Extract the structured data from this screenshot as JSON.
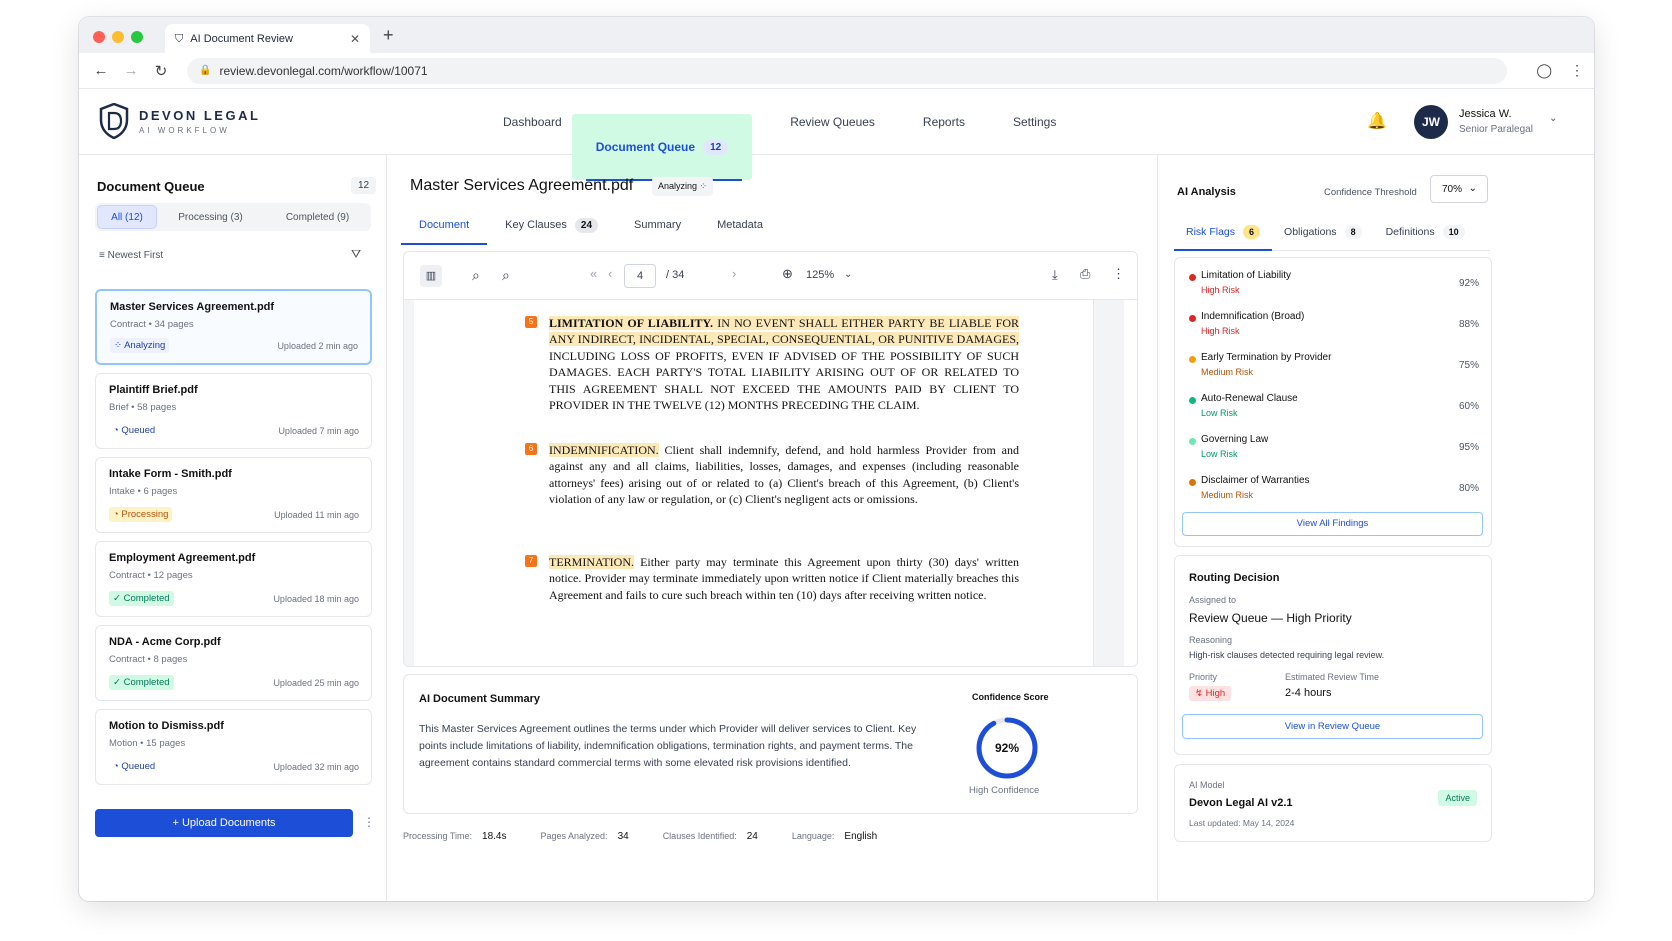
{
  "browser": {
    "tab_title": "AI Document Review",
    "url": "review.devonlegal.com/workflow/10071"
  },
  "brand": {
    "name": "DEVON LEGAL",
    "sub": "AI WORKFLOW"
  },
  "nav": {
    "items": [
      "Dashboard",
      "Document Queue",
      "Review Queues",
      "Reports",
      "Settings"
    ],
    "queue_badge": "12"
  },
  "user": {
    "initials": "JW",
    "name": "Jessica W.",
    "role": "Senior Paralegal"
  },
  "queue": {
    "title": "Document Queue",
    "count": "12",
    "filters": [
      "All (12)",
      "Processing (3)",
      "Completed (9)"
    ],
    "sort": "Newest First",
    "docs": [
      {
        "name": "Master Services Agreement.pdf",
        "meta": "Contract  •  34 pages",
        "status": "Analyzing",
        "uploaded": "Uploaded 2 min ago"
      },
      {
        "name": "Plaintiff Brief.pdf",
        "meta": "Brief  •  58 pages",
        "status": "Queued",
        "uploaded": "Uploaded 7 min ago"
      },
      {
        "name": "Intake Form - Smith.pdf",
        "meta": "Intake  •  6 pages",
        "status": "Processing",
        "uploaded": "Uploaded 11 min ago"
      },
      {
        "name": "Employment Agreement.pdf",
        "meta": "Contract  •  12 pages",
        "status": "Completed",
        "uploaded": "Uploaded 18 min ago"
      },
      {
        "name": "NDA - Acme Corp.pdf",
        "meta": "Contract  •  8 pages",
        "status": "Completed",
        "uploaded": "Uploaded 25 min ago"
      },
      {
        "name": "Motion to Dismiss.pdf",
        "meta": "Motion  •  15 pages",
        "status": "Queued",
        "uploaded": "Uploaded 32 min ago"
      }
    ],
    "upload_label": "+  Upload Documents"
  },
  "doc": {
    "title": "Master Services Agreement.pdf",
    "status": "Analyzing",
    "tabs": [
      "Document",
      "Key Clauses",
      "Summary",
      "Metadata"
    ],
    "clauses_count": "24",
    "page": "4",
    "total_pages": "/ 34",
    "zoom": "125%",
    "clauses": [
      {
        "num": "5",
        "heading": "LIMITATION OF LIABILITY.",
        "hl_text": " IN NO EVENT SHALL EITHER PARTY BE LIABLE FOR ANY INDIRECT, INCIDENTAL, SPECIAL, CONSEQUENTIAL, OR PUNITIVE DAMAGES,",
        "text": " INCLUDING LOSS OF PROFITS, EVEN IF ADVISED OF THE POSSIBILITY OF SUCH DAMAGES. EACH PARTY'S TOTAL LIABILITY ARISING OUT OF OR RELATED TO THIS AGREEMENT SHALL NOT EXCEED THE AMOUNTS PAID BY CLIENT TO PROVIDER IN THE TWELVE (12) MONTHS PRECEDING THE CLAIM."
      },
      {
        "num": "6",
        "heading": "INDEMNIFICATION.",
        "hl_text": "",
        "text": " Client shall indemnify, defend, and hold harmless Provider from and against any and all claims, liabilities, losses, damages, and expenses (including reasonable attorneys' fees) arising out of or related to (a) Client's breach of this Agreement, (b) Client's violation of any law or regulation, or (c) Client's negligent acts or omissions."
      },
      {
        "num": "7",
        "heading": "TERMINATION.",
        "hl_text": "",
        "text": " Either party may terminate this Agreement upon thirty (30) days' written notice. Provider may terminate immediately upon written notice if Client materially breaches this Agreement and fails to cure such breach within ten (10) days after receiving written notice."
      }
    ]
  },
  "summary": {
    "title": "AI Document Summary",
    "body": "This Master Services Agreement outlines the terms under which Provider will deliver services to Client. Key points include limitations of liability, indemnification obligations, termination rights, and payment terms. The agreement contains standard commercial terms with some elevated risk provisions identified.",
    "confidence_label": "Confidence Score",
    "confidence": 0.92,
    "confidence_text": "92%",
    "confidence_desc": "High Confidence"
  },
  "stats": {
    "processing_label": "Processing Time:",
    "processing": "18.4s",
    "pages_label": "Pages Analyzed:",
    "pages": "34",
    "clauses_label": "Clauses Identified:",
    "clauses": "24",
    "lang_label": "Language:",
    "lang": "English"
  },
  "analysis": {
    "title": "AI Analysis",
    "threshold_label": "Confidence Threshold",
    "threshold": "70%",
    "tabs": [
      {
        "label": "Risk Flags",
        "count": "6"
      },
      {
        "label": "Obligations",
        "count": "8"
      },
      {
        "label": "Definitions",
        "count": "10"
      }
    ],
    "flags": [
      {
        "name": "Limitation of Liability",
        "risk": "High Risk",
        "pct": "92%",
        "color": "#dc2626"
      },
      {
        "name": "Indemnification (Broad)",
        "risk": "High Risk",
        "pct": "88%",
        "color": "#dc2626"
      },
      {
        "name": "Early Termination by Provider",
        "risk": "Medium Risk",
        "pct": "75%",
        "color": "#f59e0b"
      },
      {
        "name": "Auto-Renewal Clause",
        "risk": "Low Risk",
        "pct": "60%",
        "color": "#10b981"
      },
      {
        "name": "Governing Law",
        "risk": "Low Risk",
        "pct": "95%",
        "color": "#6ee7b7"
      },
      {
        "name": "Disclaimer of Warranties",
        "risk": "Medium Risk",
        "pct": "80%",
        "color": "#d97706"
      }
    ],
    "view_all": "View All Findings"
  },
  "routing": {
    "title": "Routing Decision",
    "assigned_label": "Assigned to",
    "queue": "Review Queue — High Priority",
    "reasoning_label": "Reasoning",
    "reasoning": "High-risk clauses detected requiring legal review.",
    "priority_label": "Priority",
    "priority": "High",
    "est_label": "Estimated Review Time",
    "est": "2-4 hours",
    "button": "View in Review Queue"
  },
  "model": {
    "label": "AI Model",
    "name": "Devon Legal AI v2.1",
    "updated": "Last updated: May 14, 2024",
    "status": "Active"
  }
}
